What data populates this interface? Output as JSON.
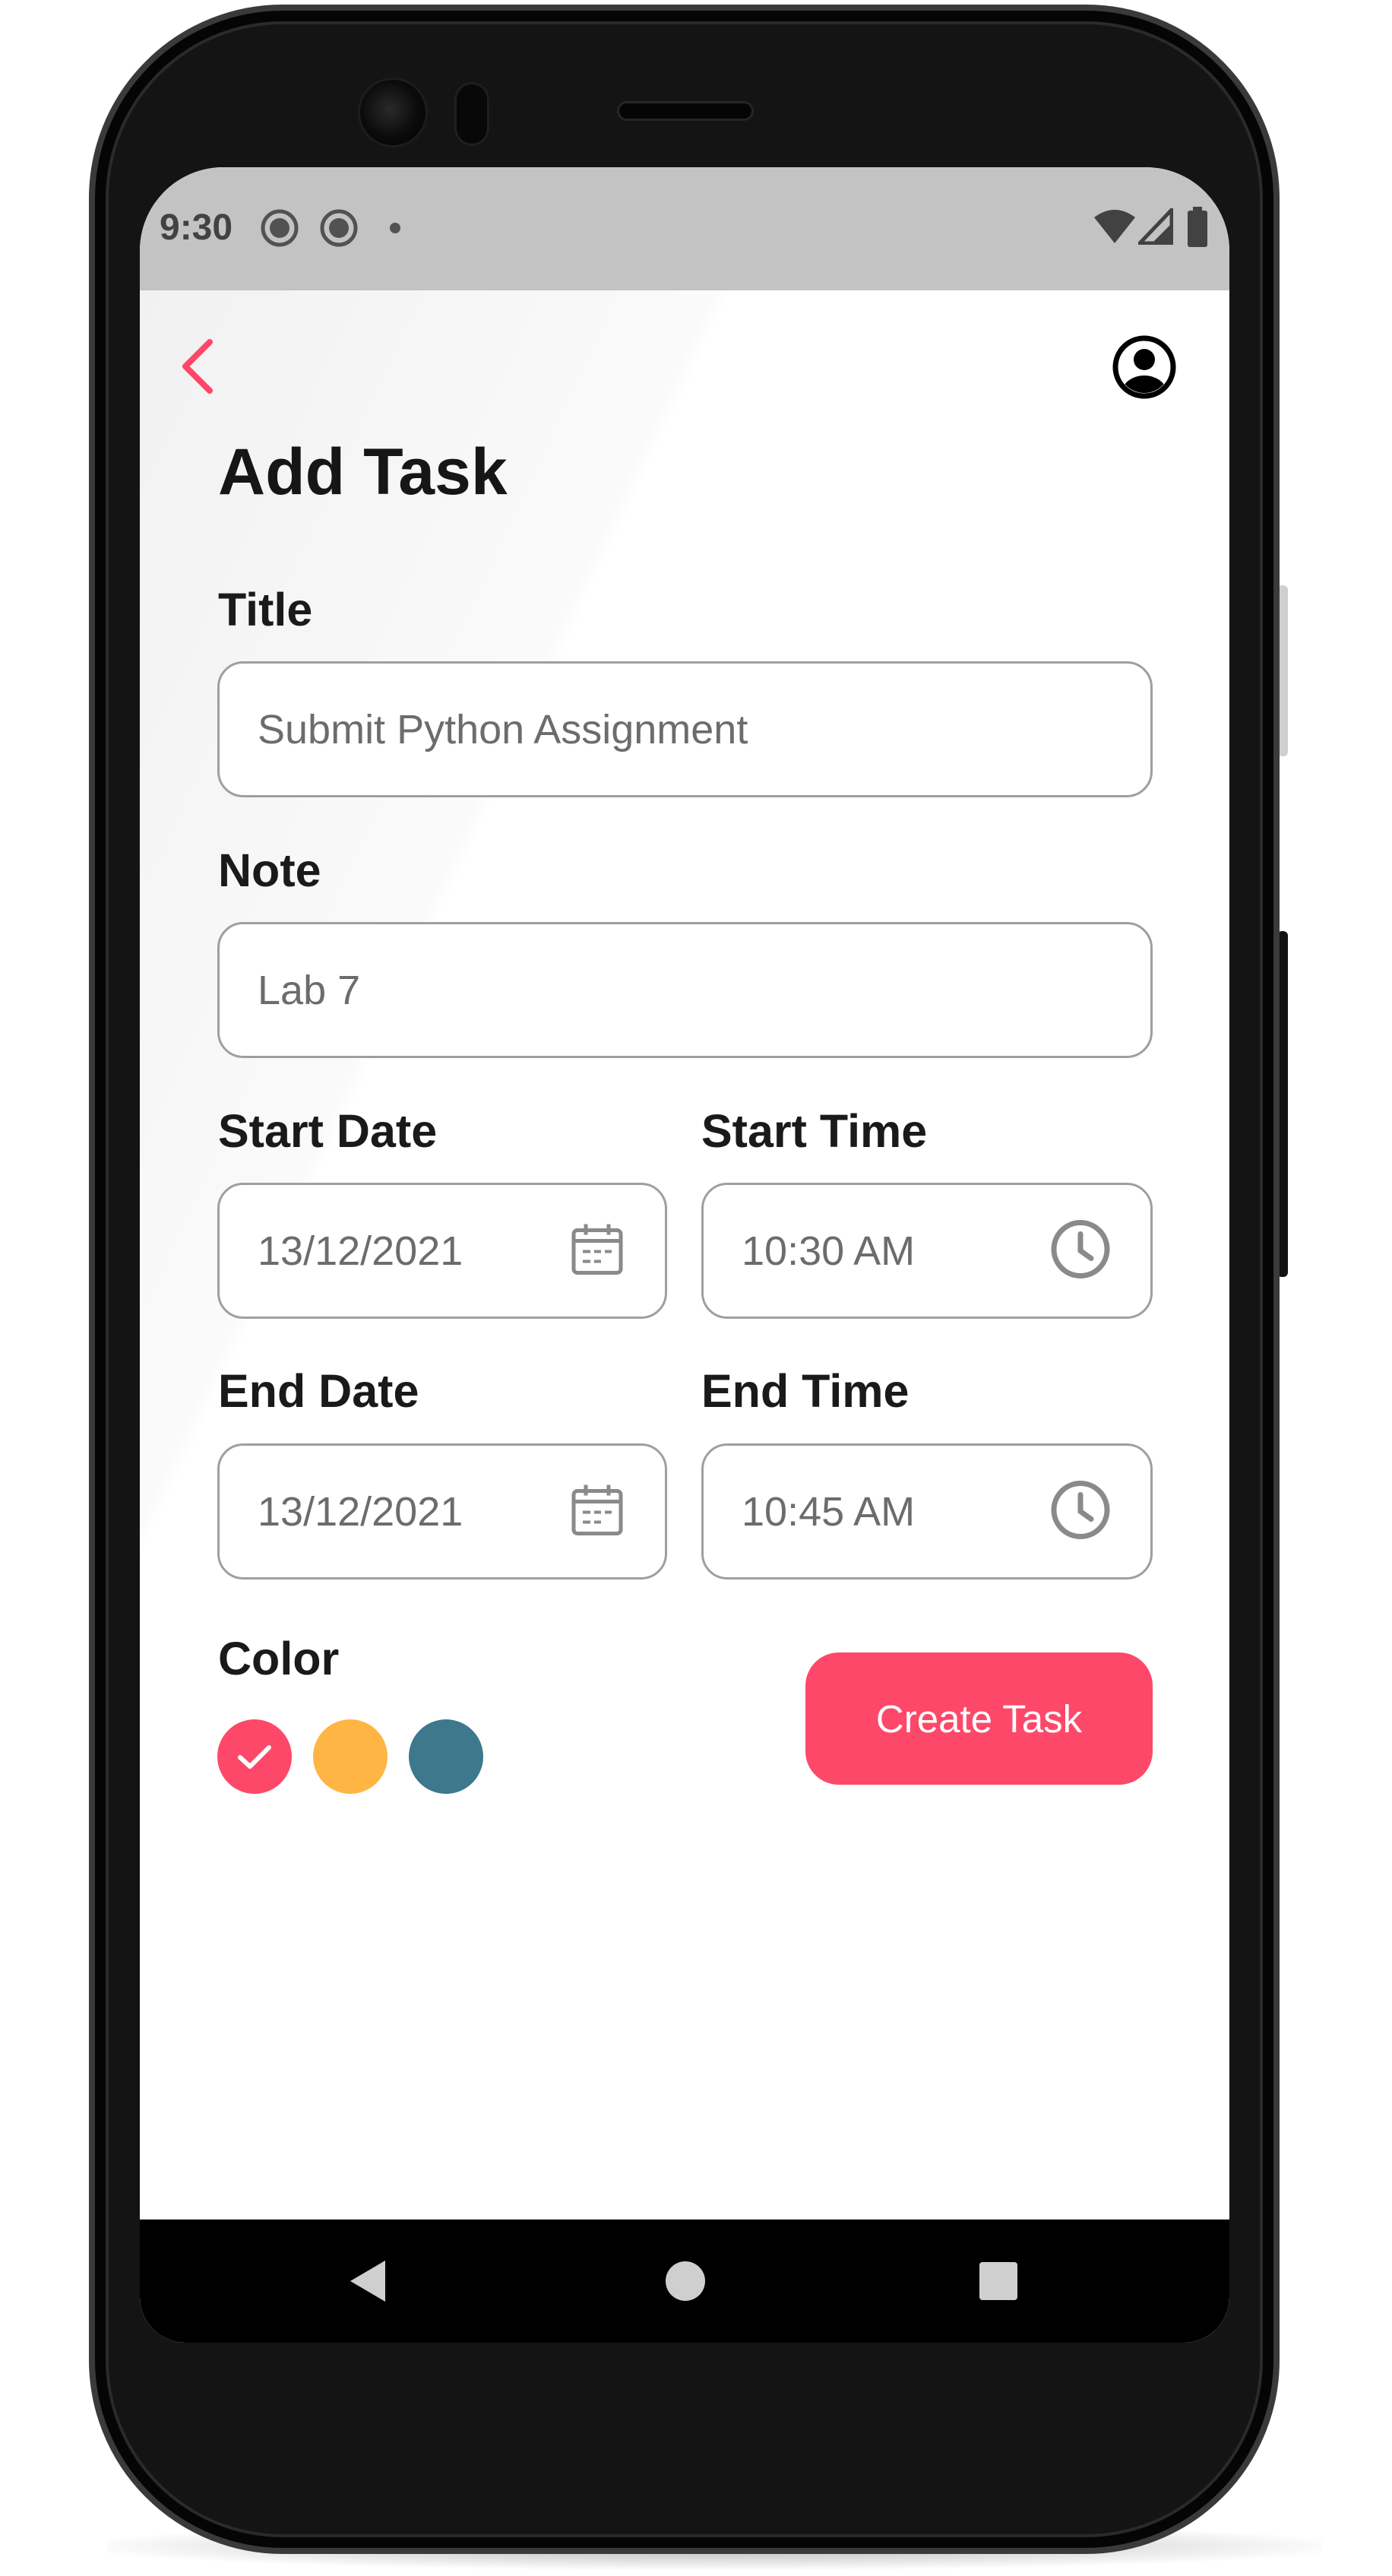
{
  "status_bar": {
    "time": "9:30",
    "icons": [
      "notification-icon",
      "notification-icon",
      "dot-icon",
      "wifi-icon",
      "signal-icon",
      "battery-icon"
    ]
  },
  "header": {
    "back_icon": "chevron-left-icon",
    "profile_icon": "account-circle-icon"
  },
  "page_title": "Add Task",
  "form": {
    "title": {
      "label": "Title",
      "value": "Submit Python Assignment"
    },
    "note": {
      "label": "Note",
      "value": "Lab 7"
    },
    "start_date": {
      "label": "Start Date",
      "value": "13/12/2021",
      "icon": "calendar-icon"
    },
    "start_time": {
      "label": "Start Time",
      "value": "10:30 AM",
      "icon": "clock-icon"
    },
    "end_date": {
      "label": "End Date",
      "value": "13/12/2021",
      "icon": "calendar-icon"
    },
    "end_time": {
      "label": "End Time",
      "value": "10:45 AM",
      "icon": "clock-icon"
    },
    "color": {
      "label": "Color",
      "options": [
        {
          "hex": "#fe4869",
          "selected": true
        },
        {
          "hex": "#ffb544",
          "selected": false
        },
        {
          "hex": "#3d788c",
          "selected": false
        }
      ]
    },
    "submit_label": "Create Task"
  },
  "colors": {
    "accent": "#fe4869",
    "text": "#161616",
    "field_text": "#6c6c6c",
    "border": "#9f9f9f"
  },
  "nav_bar": {
    "icons": [
      "back-triangle-icon",
      "home-circle-icon",
      "recents-square-icon"
    ]
  }
}
